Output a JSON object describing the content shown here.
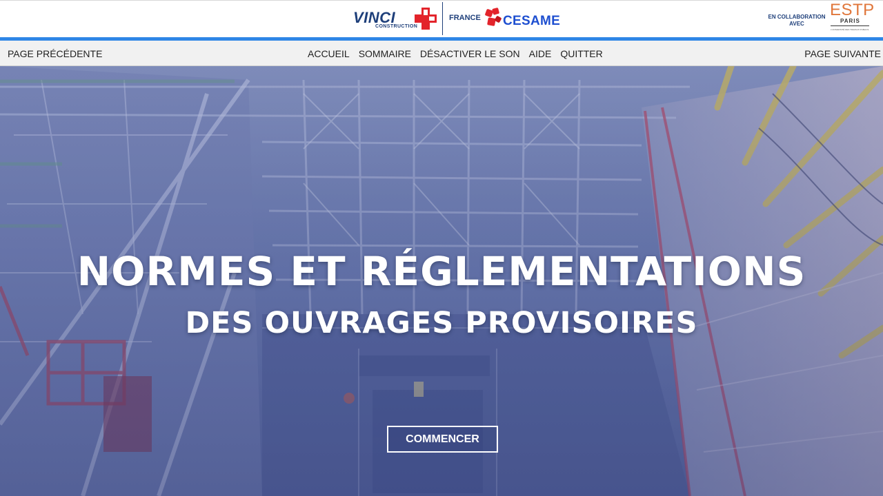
{
  "header": {
    "vinci": {
      "word": "VINCI",
      "sub": "CONSTRUCTION"
    },
    "country": "FRANCE",
    "cesame": "CESAME",
    "collab": {
      "line1": "EN COLLABORATION",
      "line2": "AVEC"
    },
    "estp": {
      "word": "ESTP",
      "city": "PARIS",
      "tagline": "L'UNIVERSITÉ DES TRAVAUX PUBLICS"
    }
  },
  "nav": {
    "prev": "PAGE PRÉCÉDENTE",
    "next": "PAGE SUIVANTE",
    "items": [
      {
        "label": "ACCUEIL"
      },
      {
        "label": "SOMMAIRE"
      },
      {
        "label": "DÉSACTIVER LE SON"
      },
      {
        "label": "AIDE"
      },
      {
        "label": "QUITTER"
      }
    ]
  },
  "hero": {
    "title": "NORMES ET RÉGLEMENTATIONS",
    "subtitle": "DES OUVRAGES PROVISOIRES",
    "start_label": "COMMENCER"
  },
  "colors": {
    "accent_blue": "#2f86e6",
    "vinci_navy": "#1e3f7a",
    "vinci_red": "#e3242b",
    "cesame_blue": "#1e4fd0",
    "estp_orange": "#e0763a",
    "hero_overlay": "#5a6aa8"
  },
  "icons": {
    "vinci_logo": "vinci-cross-logo",
    "cesame_logo": "cesame-puzzle-logo",
    "estp_logo": "estp-wordmark"
  }
}
